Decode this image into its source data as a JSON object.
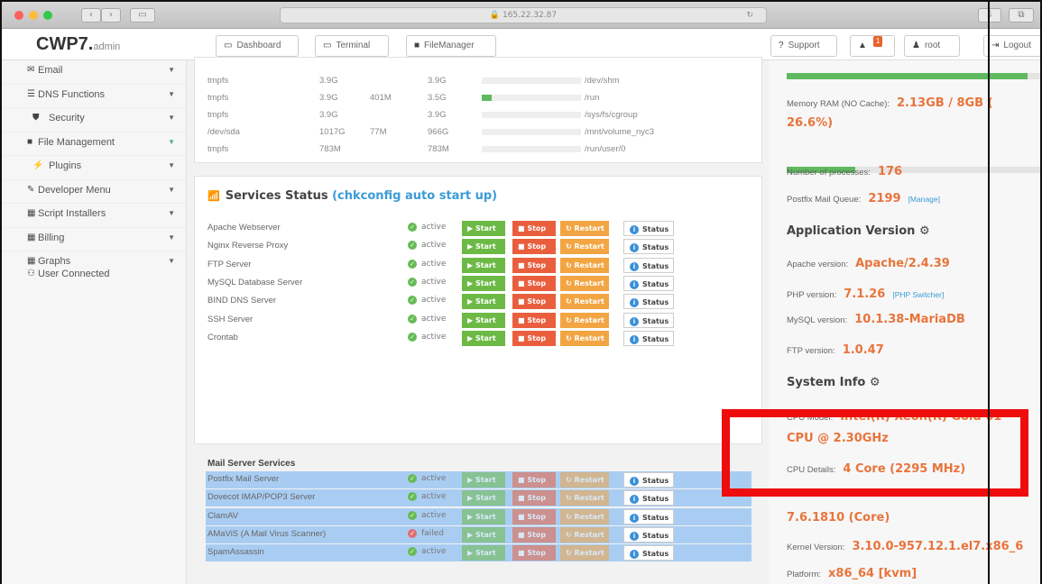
{
  "browser": {
    "url": "165.22.32.87"
  },
  "app": {
    "logo": "CWP7.",
    "logo_suffix": "admin"
  },
  "header": {
    "dashboard": "Dashboard",
    "terminal": "Terminal",
    "filemanager": "FileManager",
    "support": "Support",
    "notif_count": "1",
    "user": "root",
    "logout": "Logout"
  },
  "sidebar": {
    "items": [
      {
        "label": "Email",
        "icon": "envelope-icon"
      },
      {
        "label": "DNS Functions",
        "icon": "list-icon"
      },
      {
        "label": "Security",
        "icon": "shield-icon"
      },
      {
        "label": "File Management",
        "icon": "folder-icon"
      },
      {
        "label": "Plugins",
        "icon": "plug-icon"
      },
      {
        "label": "Developer Menu",
        "icon": "wrench-icon"
      },
      {
        "label": "Script Installers",
        "icon": "grid-icon"
      },
      {
        "label": "Billing",
        "icon": "grid-icon"
      },
      {
        "label": "Graphs",
        "icon": "grid-icon"
      },
      {
        "label": "User Connected",
        "icon": "users-icon"
      }
    ]
  },
  "disk": {
    "rows": [
      {
        "fs": "tmpfs",
        "size": "3.9G",
        "used": "",
        "avail": "3.9G",
        "usage": 0,
        "mount": "/dev/shm"
      },
      {
        "fs": "tmpfs",
        "size": "3.9G",
        "used": "401M",
        "avail": "3.5G",
        "usage": 0.1,
        "mount": "/run"
      },
      {
        "fs": "tmpfs",
        "size": "3.9G",
        "used": "",
        "avail": "3.9G",
        "usage": 0,
        "mount": "/sys/fs/cgroup"
      },
      {
        "fs": "/dev/sda",
        "size": "1017G",
        "used": "77M",
        "avail": "966G",
        "usage": 0,
        "mount": "/mnt/volume_nyc3"
      },
      {
        "fs": "tmpfs",
        "size": "783M",
        "used": "",
        "avail": "783M",
        "usage": 0,
        "mount": "/run/user/0"
      }
    ]
  },
  "services": {
    "title": "Services Status",
    "title_hl": "(chkconfig auto start up)",
    "btn_start": "Start",
    "btn_stop": "Stop",
    "btn_restart": "Restart",
    "btn_status": "Status",
    "mail_header": "Mail Server Services",
    "rows": [
      {
        "name": "Apache Webserver",
        "status": "active"
      },
      {
        "name": "Nginx Reverse Proxy",
        "status": "active"
      },
      {
        "name": "FTP Server",
        "status": "active"
      },
      {
        "name": "MySQL Database Server",
        "status": "active"
      },
      {
        "name": "BIND DNS Server",
        "status": "active"
      },
      {
        "name": "SSH Server",
        "status": "active"
      },
      {
        "name": "Crontab",
        "status": "active"
      }
    ],
    "mail_rows": [
      {
        "name": "Postfix Mail Server",
        "status": "active"
      },
      {
        "name": "Dovecot IMAP/POP3 Server",
        "status": "active"
      },
      {
        "name": "ClamAV",
        "status": "active"
      },
      {
        "name": "AMaViS (A Mail Virus Scanner)",
        "status": "failed"
      },
      {
        "name": "SpamAssassin",
        "status": "active"
      }
    ]
  },
  "right": {
    "mem_label": "Memory RAM (NO Cache):",
    "mem_value": "2.13GB / 8GB (",
    "mem_value2": "26.6%)",
    "mem_fill": 0.95,
    "mem2_fill": 0.27,
    "proc_label": "Number of processes:",
    "proc_value": "176",
    "queue_label": "Postfix Mail Queue:",
    "queue_value": "2199",
    "queue_link": "[Manage]",
    "appver_title": "Application Version",
    "apache_label": "Apache version:",
    "apache_value": "Apache/2.4.39",
    "php_label": "PHP version:",
    "php_value": "7.1.26",
    "php_link": "[PHP Switcher]",
    "mysql_label": "MySQL version:",
    "mysql_value": "10.1.38-MariaDB",
    "ftp_label": "FTP version:",
    "ftp_value": "1.0.47",
    "sysinfo_title": "System Info",
    "cpu_label": "CPU Model:",
    "cpu_value": "Intel(R) Xeon(R) Gold 61",
    "cpu_value2": "CPU @ 2.30GHz",
    "cpud_label": "CPU Details:",
    "cpud_value": "4 Core (2295 MHz)",
    "os_value2": "7.6.1810 (Core)",
    "kernel_label": "Kernel Version:",
    "kernel_value": "3.10.0-957.12.1.el7.x86_6",
    "platform_label": "Platform:",
    "platform_value": "x86_64 [kvm]"
  }
}
